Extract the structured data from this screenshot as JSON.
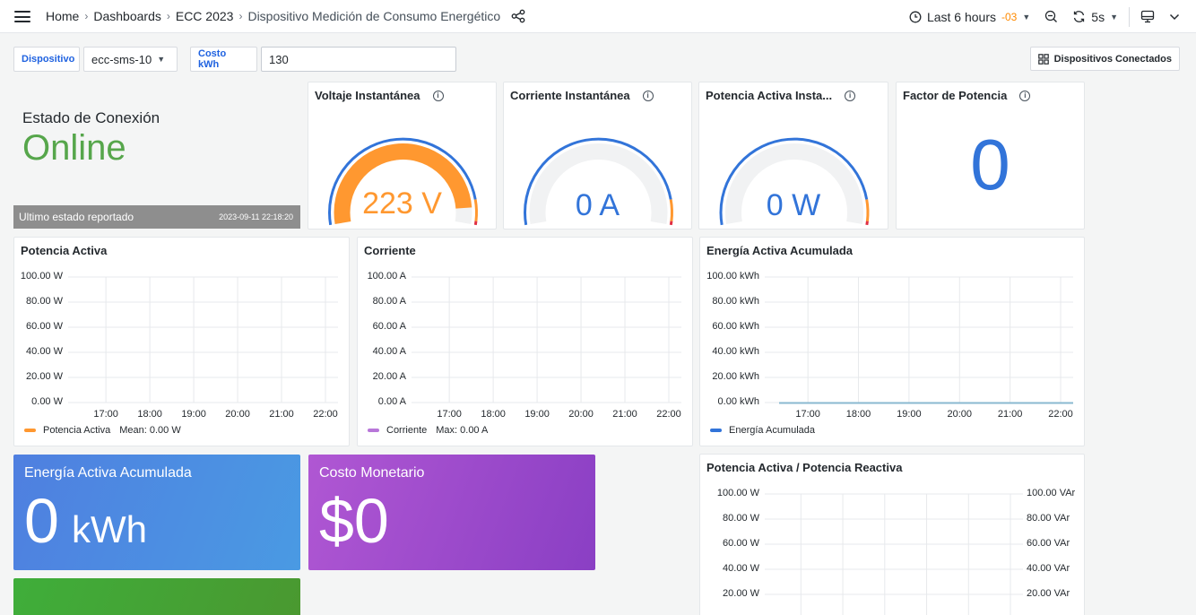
{
  "topbar": {
    "breadcrumbs": [
      "Home",
      "Dashboards",
      "ECC 2023",
      "Dispositivo Medición de Consumo Energético"
    ],
    "time_range": "Last 6 hours",
    "timezone": "-03",
    "refresh": "5s"
  },
  "variables": {
    "device_label": "Dispositivo",
    "device_value": "ecc-sms-10",
    "cost_label": "Costo kWh",
    "cost_value": "130",
    "devices_button": "Dispositivos Conectados"
  },
  "status": {
    "title": "Estado de Conexión",
    "value": "Online",
    "footer_label": "Ultimo estado reportado",
    "footer_time": "2023-09-11 22:18:20",
    "color": "#56a64b"
  },
  "gauges": [
    {
      "title": "Voltaje Instantánea",
      "value": "223 V",
      "fraction": 0.93,
      "color": "#ff9830"
    },
    {
      "title": "Corriente Instantánea",
      "value": "0 A",
      "fraction": 0,
      "color": "#3274d9"
    },
    {
      "title": "Potencia Activa Insta...",
      "value": "0 W",
      "fraction": 0,
      "color": "#3274d9"
    }
  ],
  "power_factor": {
    "title": "Factor de Potencia",
    "value": "0"
  },
  "charts": {
    "potencia": {
      "title": "Potencia Activa",
      "yticks": [
        "100.00 W",
        "80.00 W",
        "60.00 W",
        "40.00 W",
        "20.00 W",
        "0.00 W"
      ],
      "xticks": [
        "17:00",
        "18:00",
        "19:00",
        "20:00",
        "21:00",
        "22:00"
      ],
      "legend_name": "Potencia Activa",
      "legend_stat": "Mean: 0.00 W",
      "color": "#ff9830"
    },
    "corriente": {
      "title": "Corriente",
      "yticks": [
        "100.00 A",
        "80.00 A",
        "60.00 A",
        "40.00 A",
        "20.00 A",
        "0.00 A"
      ],
      "xticks": [
        "17:00",
        "18:00",
        "19:00",
        "20:00",
        "21:00",
        "22:00"
      ],
      "legend_name": "Corriente",
      "legend_stat": "Max: 0.00 A",
      "color": "#b877d9"
    },
    "energia": {
      "title": "Energía Activa Acumulada",
      "yticks": [
        "100.00 kWh",
        "80.00 kWh",
        "60.00 kWh",
        "40.00 kWh",
        "20.00 kWh",
        "0.00 kWh"
      ],
      "xticks": [
        "17:00",
        "18:00",
        "19:00",
        "20:00",
        "21:00",
        "22:00"
      ],
      "legend_name": "Energía Acumulada",
      "color": "#3274d9"
    },
    "reactiva": {
      "title": "Potencia Activa / Potencia Reactiva",
      "yticks": [
        "100.00 W",
        "80.00 W",
        "60.00 W",
        "40.00 W",
        "20.00 W"
      ],
      "yticks_right": [
        "100.00 VAr",
        "80.00 VAr",
        "60.00 VAr",
        "40.00 VAr",
        "20.00 VAr"
      ]
    }
  },
  "tiles": {
    "energia": {
      "title": "Energía Activa Acumulada",
      "value": "0",
      "unit": "kWh"
    },
    "costo": {
      "title": "Costo Monetario",
      "value": "$0"
    },
    "bottom": {
      "title": ""
    }
  }
}
